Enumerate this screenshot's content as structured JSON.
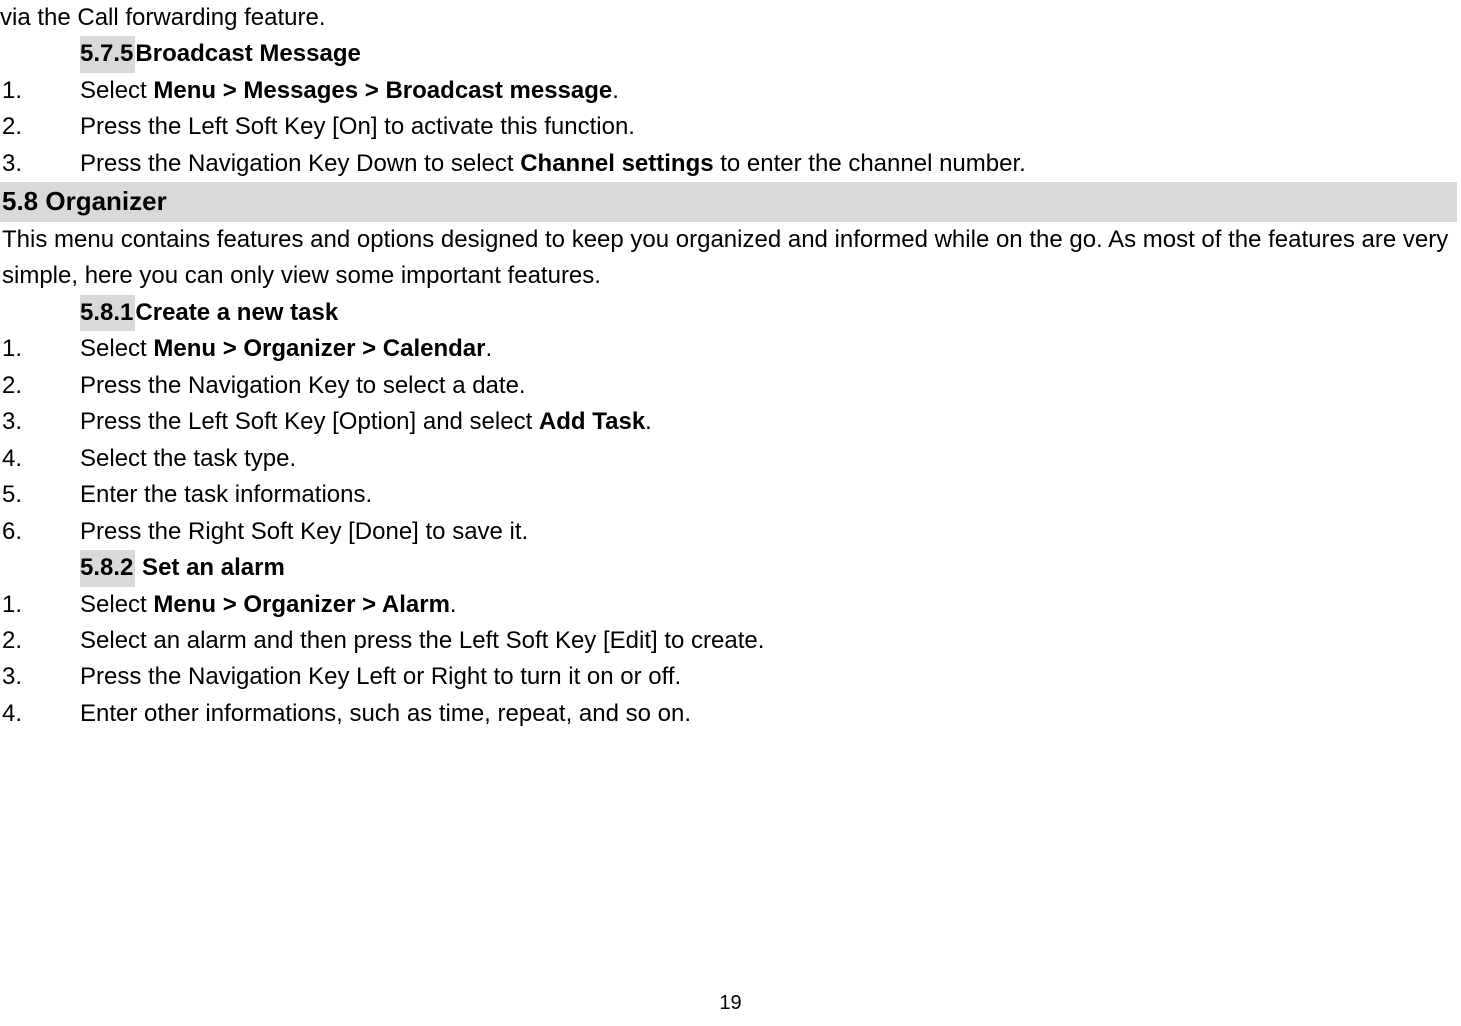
{
  "intro_line": "via the Call forwarding feature.",
  "sec575": {
    "num": "5.7.5 ",
    "title": "Broadcast Message"
  },
  "s575": {
    "n1": "1.",
    "l1_pre": "Select ",
    "l1_bold": "Menu > Messages > Broadcast message",
    "l1_post": ".",
    "n2": "2.",
    "l2": "Press the Left Soft Key [On] to activate this function.",
    "n3": "3.",
    "l3_pre": "Press the Navigation Key Down to select ",
    "l3_bold": "Channel settings",
    "l3_post": " to enter the channel number."
  },
  "sec58": "5.8 Organizer",
  "sec58_para": "This menu contains features and options designed to keep you organized and informed while on the go. As most of the features are very simple, here you can only view some important features.",
  "sec581": {
    "num": "5.8.1 ",
    "title": "Create a new task"
  },
  "s581": {
    "n1": "1.",
    "l1_pre": "Select ",
    "l1_bold": "Menu > Organizer > Calendar",
    "l1_post": ".",
    "n2": "2.",
    "l2": "Press the Navigation Key to select a date.",
    "n3": "3.",
    "l3_pre": "Press the Left Soft Key [Option] and select ",
    "l3_bold": "Add Task",
    "l3_post": ".",
    "n4": "4.",
    "l4": "Select the task type.",
    "n5": "5.",
    "l5": "Enter the task informations.",
    "n6": "6.",
    "l6": "Press the Right Soft Key [Done] to save it."
  },
  "sec582": {
    "num": "5.8.2  ",
    "title": " Set an alarm"
  },
  "s582": {
    "n1": "1.",
    "l1_pre": "Select ",
    "l1_bold": "Menu > Organizer > Alarm",
    "l1_post": ".",
    "n2": "2.",
    "l2": "Select an alarm and then press the Left Soft Key [Edit] to create.",
    "n3": "3.",
    "l3": "Press the Navigation Key Left or Right to turn it on or off.",
    "n4": "4.",
    "l4": "Enter other informations, such as time, repeat, and so on."
  },
  "page_number": "19"
}
